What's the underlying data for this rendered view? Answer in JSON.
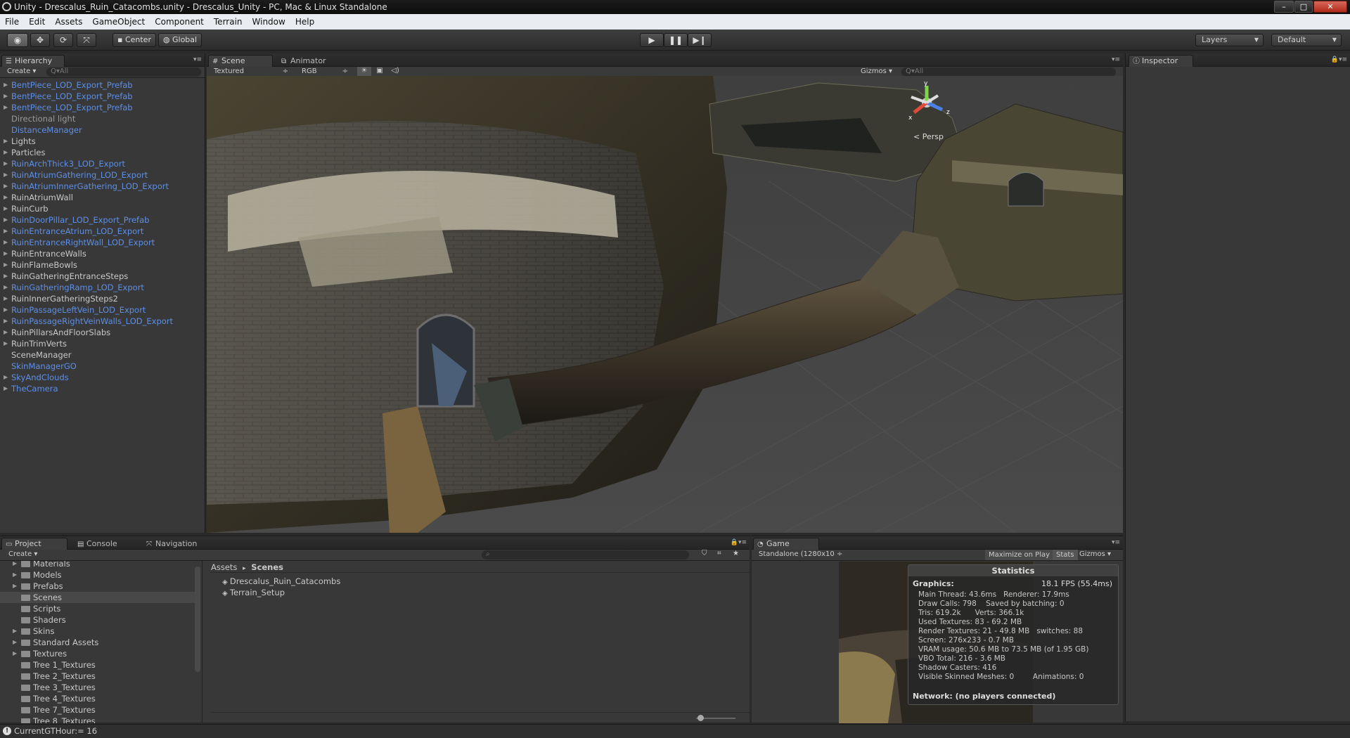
{
  "window": {
    "title": "Unity - Drescalus_Ruin_Catacombs.unity - Drescalus_Unity - PC, Mac & Linux Standalone",
    "buttons": {
      "minimize": "–",
      "maximize": "□",
      "close": "✕"
    }
  },
  "menu": [
    "File",
    "Edit",
    "Assets",
    "GameObject",
    "Component",
    "Terrain",
    "Window",
    "Help"
  ],
  "toolbar": {
    "pivot_label": "Center",
    "space_label": "Global",
    "layers_label": "Layers",
    "layout_label": "Default",
    "play_icon": "play-icon",
    "pause_icon": "pause-icon",
    "step_icon": "step-icon"
  },
  "hierarchy": {
    "tab_label": "Hierarchy",
    "create_label": "Create ▾",
    "search_placeholder": "Q▾All",
    "items": [
      {
        "label": "BentPiece_LOD_Export_Prefab",
        "expandable": true,
        "style": "blue"
      },
      {
        "label": "BentPiece_LOD_Export_Prefab",
        "expandable": true,
        "style": "blue"
      },
      {
        "label": "BentPiece_LOD_Export_Prefab",
        "expandable": true,
        "style": "blue"
      },
      {
        "label": "Directional light",
        "expandable": false,
        "style": "dim"
      },
      {
        "label": "DistanceManager",
        "expandable": false,
        "style": "blue"
      },
      {
        "label": "Lights",
        "expandable": true,
        "style": "grey"
      },
      {
        "label": "Particles",
        "expandable": true,
        "style": "grey"
      },
      {
        "label": "RuinArchThick3_LOD_Export",
        "expandable": true,
        "style": "blue"
      },
      {
        "label": "RuinAtriumGathering_LOD_Export",
        "expandable": true,
        "style": "blue"
      },
      {
        "label": "RuinAtriumInnerGathering_LOD_Export",
        "expandable": true,
        "style": "blue"
      },
      {
        "label": "RuinAtriumWall",
        "expandable": true,
        "style": "grey"
      },
      {
        "label": "RuinCurb",
        "expandable": true,
        "style": "grey"
      },
      {
        "label": "RuinDoorPillar_LOD_Export_Prefab",
        "expandable": true,
        "style": "blue"
      },
      {
        "label": "RuinEntranceAtrium_LOD_Export",
        "expandable": true,
        "style": "blue"
      },
      {
        "label": "RuinEntranceRightWall_LOD_Export",
        "expandable": true,
        "style": "blue"
      },
      {
        "label": "RuinEntranceWalls",
        "expandable": true,
        "style": "grey"
      },
      {
        "label": "RuinFlameBowls",
        "expandable": true,
        "style": "grey"
      },
      {
        "label": "RuinGatheringEntranceSteps",
        "expandable": true,
        "style": "grey"
      },
      {
        "label": "RuinGatheringRamp_LOD_Export",
        "expandable": true,
        "style": "blue"
      },
      {
        "label": "RuinInnerGatheringSteps2",
        "expandable": true,
        "style": "grey"
      },
      {
        "label": "RuinPassageLeftVein_LOD_Export",
        "expandable": true,
        "style": "blue"
      },
      {
        "label": "RuinPassageRightVeinWalls_LOD_Export",
        "expandable": true,
        "style": "blue"
      },
      {
        "label": "RuinPillarsAndFloorSlabs",
        "expandable": true,
        "style": "grey"
      },
      {
        "label": "RuinTrimVerts",
        "expandable": true,
        "style": "grey"
      },
      {
        "label": "SceneManager",
        "expandable": false,
        "style": "grey"
      },
      {
        "label": "SkinManagerGO",
        "expandable": false,
        "style": "blue"
      },
      {
        "label": "SkyAndClouds",
        "expandable": true,
        "style": "blue"
      },
      {
        "label": "TheCamera",
        "expandable": true,
        "style": "blue"
      }
    ]
  },
  "scene": {
    "tab_label": "Scene",
    "animator_tab_label": "Animator",
    "render_mode": "Textured",
    "color_mode": "RGB",
    "gizmos_label": "Gizmos ▾",
    "search_placeholder": "Q▾All",
    "persp_label": "< Persp",
    "axis_y": "y",
    "axis_z": "z",
    "axis_x": "x"
  },
  "inspector": {
    "tab_label": "Inspector"
  },
  "project": {
    "tab_label": "Project",
    "console_tab_label": "Console",
    "navigation_tab_label": "Navigation",
    "create_label": "Create ▾",
    "breadcrumb_root": "Assets",
    "breadcrumb_sep": "▸",
    "breadcrumb_current": "Scenes",
    "folders": [
      {
        "label": "Materials",
        "expandable": true,
        "selected": false
      },
      {
        "label": "Models",
        "expandable": true,
        "selected": false
      },
      {
        "label": "Prefabs",
        "expandable": true,
        "selected": false
      },
      {
        "label": "Scenes",
        "expandable": false,
        "selected": true
      },
      {
        "label": "Scripts",
        "expandable": false,
        "selected": false
      },
      {
        "label": "Shaders",
        "expandable": false,
        "selected": false
      },
      {
        "label": "Skins",
        "expandable": true,
        "selected": false
      },
      {
        "label": "Standard Assets",
        "expandable": true,
        "selected": false
      },
      {
        "label": "Textures",
        "expandable": true,
        "selected": false
      },
      {
        "label": "Tree 1_Textures",
        "expandable": false,
        "selected": false
      },
      {
        "label": "Tree 2_Textures",
        "expandable": false,
        "selected": false
      },
      {
        "label": "Tree 3_Textures",
        "expandable": false,
        "selected": false
      },
      {
        "label": "Tree 4_Textures",
        "expandable": false,
        "selected": false
      },
      {
        "label": "Tree 7_Textures",
        "expandable": false,
        "selected": false
      },
      {
        "label": "Tree 8_Textures",
        "expandable": false,
        "selected": false
      }
    ],
    "files": [
      "Drescalus_Ruin_Catacombs",
      "Terrain_Setup"
    ]
  },
  "game": {
    "tab_label": "Game",
    "resolution_label": "Standalone (1280x10 ÷",
    "maximize_label": "Maximize on Play",
    "stats_label": "Stats",
    "gizmos_label": "Gizmos ▾",
    "stats": {
      "title": "Statistics",
      "graphics_label": "Graphics:",
      "fps": "18.1 FPS (55.4ms)",
      "lines": [
        "Main Thread: 43.6ms   Renderer: 17.9ms",
        "Draw Calls: 798    Saved by batching: 0",
        "Tris: 619.2k      Verts: 366.1k",
        "Used Textures: 83 - 69.2 MB",
        "Render Textures: 21 - 49.8 MB   switches: 88",
        "Screen: 276x233 - 0.7 MB",
        "VRAM usage: 50.6 MB to 73.5 MB (of 1.95 GB)",
        "VBO Total: 216 - 3.6 MB",
        "Shadow Casters: 416",
        "Visible Skinned Meshes: 0        Animations: 0"
      ],
      "network": "Network: (no players connected)"
    }
  },
  "status": {
    "message": "CurrentGTHour:= 16"
  }
}
